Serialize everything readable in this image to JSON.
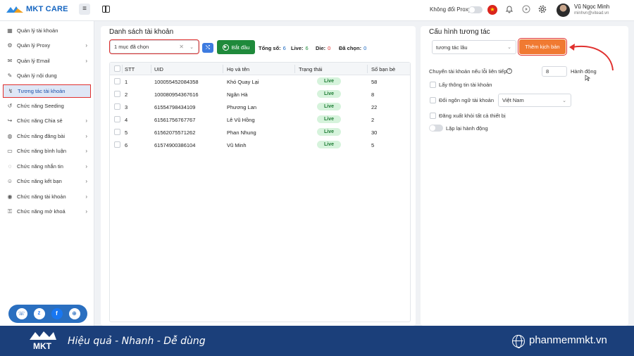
{
  "brand": {
    "name": "MKT CARE",
    "accent": "#1565c0"
  },
  "topbar": {
    "proxy_label": "Không đổi Proxy",
    "user_name": "Vũ Ngọc Minh",
    "user_email": "minhvn@vitead.vn",
    "icons": [
      "flag-vn-icon",
      "bell-icon",
      "play-icon",
      "gear-icon"
    ]
  },
  "sidebar": {
    "items": [
      {
        "label": "Quản lý tài khoản",
        "icon": "users-icon",
        "chevron": false
      },
      {
        "label": "Quản lý Proxy",
        "icon": "proxy-icon",
        "chevron": true
      },
      {
        "label": "Quản lý Email",
        "icon": "email-icon",
        "chevron": true
      },
      {
        "label": "Quản lý nội dung",
        "icon": "content-icon",
        "chevron": false
      },
      {
        "label": "Tương tác tài khoản",
        "icon": "interact-icon",
        "chevron": false,
        "active": true
      },
      {
        "label": "Chức năng Seeding",
        "icon": "seeding-icon",
        "chevron": false
      },
      {
        "label": "Chức năng Chia sẻ",
        "icon": "share-icon",
        "chevron": true
      },
      {
        "label": "Chức năng đăng bài",
        "icon": "post-icon",
        "chevron": true
      },
      {
        "label": "Chức năng bình luận",
        "icon": "comment-icon",
        "chevron": true
      },
      {
        "label": "Chức năng nhắn tin",
        "icon": "message-icon",
        "chevron": true
      },
      {
        "label": "Chức năng kết bạn",
        "icon": "friend-icon",
        "chevron": true
      },
      {
        "label": "Chức năng tài khoản",
        "icon": "account-icon",
        "chevron": true
      },
      {
        "label": "Chức năng mở khoá",
        "icon": "unlock-icon",
        "chevron": true
      }
    ]
  },
  "accounts": {
    "title": "Danh sách tài khoản",
    "select_value": "1 mục đã chọn",
    "start_label": "Bắt đầu",
    "stats": {
      "total_label": "Tổng số:",
      "total": "6",
      "live_label": "Live:",
      "live": "6",
      "die_label": "Die:",
      "die": "0",
      "selected_label": "Đã chọn:",
      "selected": "0"
    },
    "columns": [
      "STT",
      "UID",
      "Họ và tên",
      "Trạng thái",
      "Số bạn bè"
    ],
    "rows": [
      {
        "stt": "1",
        "uid": "100055452084358",
        "name": "Khó Quay Lại",
        "status": "Live",
        "friends": "58"
      },
      {
        "stt": "2",
        "uid": "100080954367616",
        "name": "Ngân Hà",
        "status": "Live",
        "friends": "8"
      },
      {
        "stt": "3",
        "uid": "61554798434109",
        "name": "Phương Lan",
        "status": "Live",
        "friends": "22"
      },
      {
        "stt": "4",
        "uid": "61561756767767",
        "name": "Lê Vũ Hồng",
        "status": "Live",
        "friends": "2"
      },
      {
        "stt": "5",
        "uid": "61562075571262",
        "name": "Phan Nhung",
        "status": "Live",
        "friends": "30"
      },
      {
        "stt": "6",
        "uid": "61574900386104",
        "name": "Vũ Minh",
        "status": "Live",
        "friends": "5"
      }
    ]
  },
  "config": {
    "title": "Cấu hình tương tác",
    "script_select": "tương tác lâu",
    "add_script_label": "Thêm kịch bản",
    "switch_label": "Chuyển tài khoản nếu lỗi liên tiếp",
    "switch_value": "8",
    "switch_unit": "Hành động",
    "get_info_label": "Lấy thông tin tài khoản",
    "change_lang_label": "Đổi ngôn ngữ tài khoản",
    "lang_value": "Việt Nam",
    "logout_label": "Đăng xuất khỏi tất cả thiết bị",
    "repeat_label": "Lặp lại hành động"
  },
  "footer": {
    "slogan": "Hiệu quả - Nhanh - Dễ dùng",
    "site": "phanmemmkt.vn",
    "logo_text": "MKT"
  },
  "colors": {
    "footer_bg": "#1b3f7a",
    "start_btn": "#1f8a3b",
    "add_btn": "#f07a32",
    "highlight": "#e0302e"
  }
}
